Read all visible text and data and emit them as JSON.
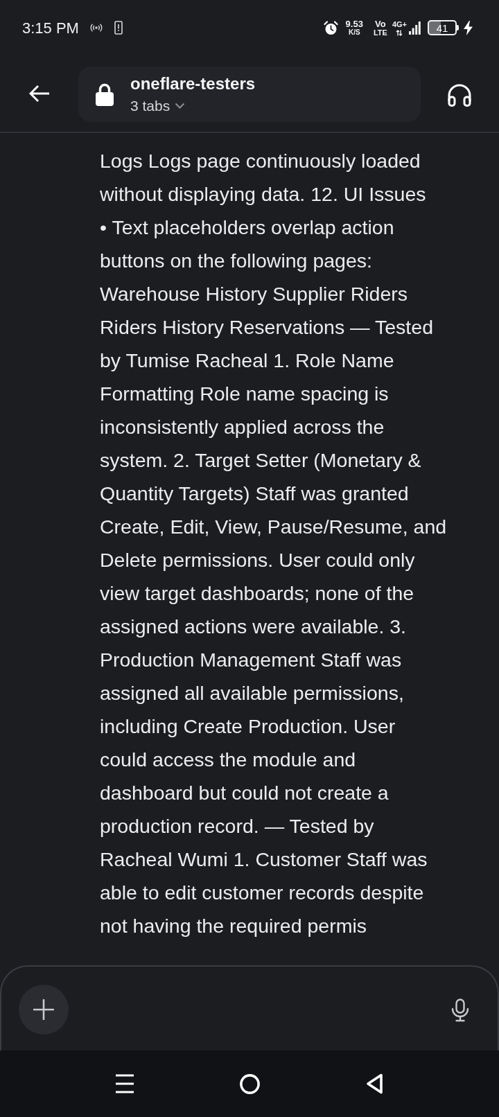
{
  "status_bar": {
    "time": "3:15 PM",
    "speed": "9.53",
    "speed_unit": "K/S",
    "volte": [
      "Vo",
      "LTE"
    ],
    "network_type": "4G+",
    "battery": "41"
  },
  "header": {
    "title": "oneflare-testers",
    "tab_count": "3 tabs"
  },
  "message": {
    "lines": [
      "Logs Logs page continuously loaded",
      "without displaying data. 12. UI Issues",
      "• Text placeholders overlap action",
      "buttons on the following pages:",
      "Warehouse History Supplier Riders",
      "Riders History Reservations — Tested",
      "by Tumise Racheal 1. Role Name",
      "Formatting Role name spacing is",
      "inconsistently applied across the",
      "system. 2. Target Setter (Monetary &",
      "Quantity Targets) Staff was granted",
      "Create, Edit, View, Pause/Resume, and",
      "Delete permissions. User could only",
      "view target dashboards; none of the",
      "assigned actions were available. 3.",
      "Production Management Staff was",
      "assigned all available permissions,",
      "including Create Production. User",
      "could access the module and",
      "dashboard but could not create a",
      "production record. — Tested by",
      "Racheal Wumi 1. Customer Staff was",
      "able to edit customer records despite",
      "not having the required permis"
    ]
  }
}
